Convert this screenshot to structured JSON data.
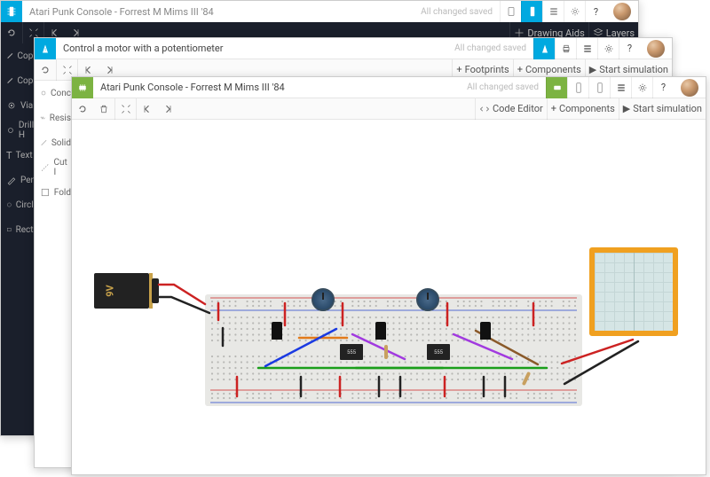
{
  "window1": {
    "title": "Atari Punk Console - Forrest M Mims III '84",
    "status": "All changed saved",
    "toolbar_right": {
      "drawing_aids": "Drawing Aids",
      "layers": "Layers"
    },
    "sidebar": [
      {
        "icon": "copper-icon",
        "label": "Copp"
      },
      {
        "icon": "copper-icon",
        "label": "Copp"
      },
      {
        "icon": "via-icon",
        "label": "Via"
      },
      {
        "icon": "drill-icon",
        "label": "Drill H"
      },
      {
        "icon": "text-icon",
        "label": "Text"
      },
      {
        "icon": "pen-icon",
        "label": "Pen"
      },
      {
        "icon": "circle-icon",
        "label": "Circle"
      },
      {
        "icon": "rect-icon",
        "label": "Recta"
      }
    ]
  },
  "window2": {
    "title": "Control a motor with a potentiometer",
    "status": "All changed saved",
    "toolbar2_right": {
      "footprints": "Footprints",
      "components": "Components",
      "start_sim": "Start simulation"
    },
    "sidebar": [
      {
        "icon": "conductor-icon",
        "label": "Conc"
      },
      {
        "icon": "resistor-icon",
        "label": "Resis"
      },
      {
        "icon": "solid-icon",
        "label": "Solid"
      },
      {
        "icon": "cut-icon",
        "label": "Cut I"
      },
      {
        "icon": "fold-icon",
        "label": "Fold"
      }
    ]
  },
  "window3": {
    "title": "Atari Punk Console - Forrest M Mims III '84",
    "status": "All changed saved",
    "toolbar2_right": {
      "code_editor": "Code Editor",
      "components": "Components",
      "start_sim": "Start simulation"
    },
    "components": {
      "battery_label": "9V",
      "chip1_label": "555",
      "chip2_label": "555"
    }
  }
}
